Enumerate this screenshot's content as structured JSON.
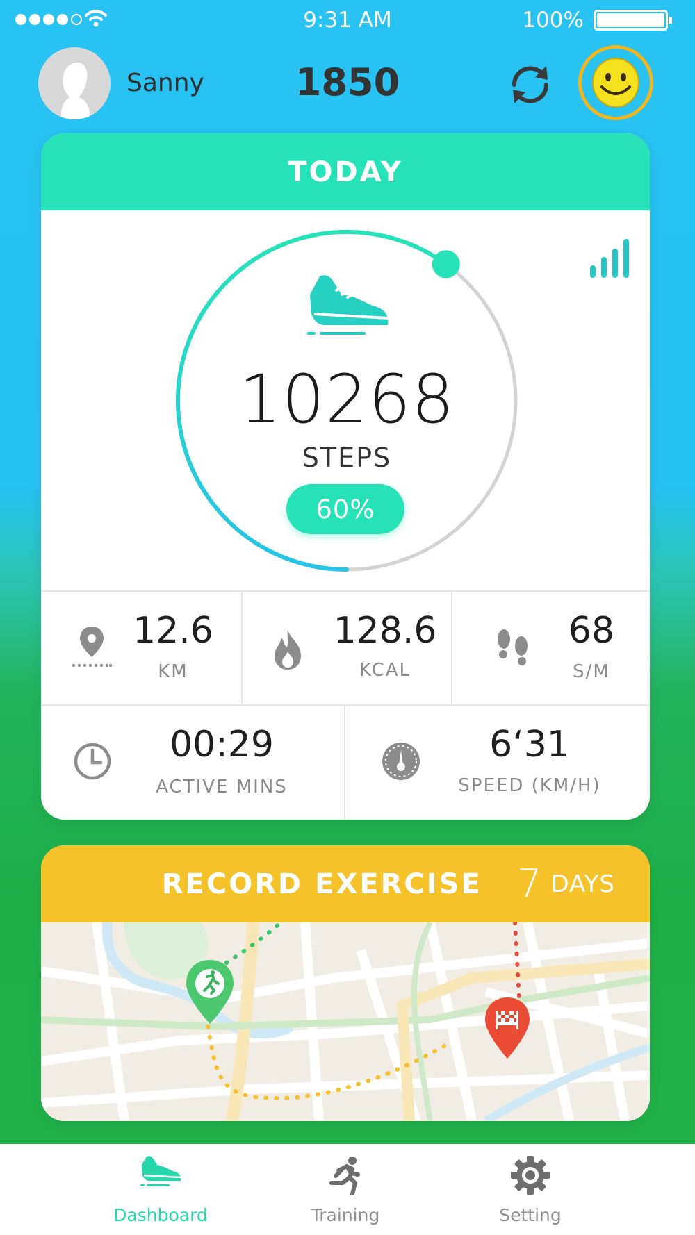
{
  "status_bar": {
    "time": "9:31 AM",
    "battery": "100%",
    "signal_icon": "signal-dots-icon",
    "wifi_icon": "wifi-icon"
  },
  "header": {
    "username": "Sanny",
    "points": "1850",
    "sync_icon": "sync-icon",
    "badge_icon": "smiley-badge-icon"
  },
  "today": {
    "title": "TODAY",
    "steps": "10268",
    "steps_label": "STEPS",
    "progress_label": "60%",
    "progress_value": 0.6,
    "accent": "#26e3b7",
    "ring_gradient_start": "#26c6e8",
    "stats": [
      {
        "icon": "location-pin-icon",
        "value": "12.6",
        "label": "KM"
      },
      {
        "icon": "flame-icon",
        "value": "128.6",
        "label": "KCAL"
      },
      {
        "icon": "footprints-icon",
        "value": "68",
        "label": "S/M"
      },
      {
        "icon": "clock-icon",
        "value": "00:29",
        "label": "ACTIVE MINS"
      },
      {
        "icon": "speedometer-icon",
        "value": "6‘31",
        "label": "SPEED (KM/H)"
      }
    ]
  },
  "record": {
    "title": "RECORD EXERCISE",
    "days_number": "7",
    "days_label": "DAYS",
    "accent": "#f5c22a"
  },
  "tabs": [
    {
      "label": "Dashboard",
      "icon": "sneaker-icon",
      "active": true
    },
    {
      "label": "Training",
      "icon": "runner-icon",
      "active": false
    },
    {
      "label": "Setting",
      "icon": "gear-icon",
      "active": false
    }
  ]
}
